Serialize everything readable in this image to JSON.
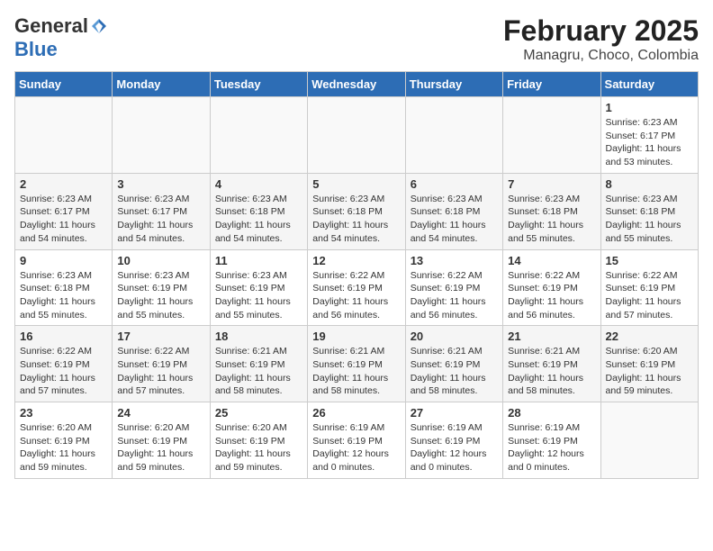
{
  "header": {
    "logo_general": "General",
    "logo_blue": "Blue",
    "month_title": "February 2025",
    "location": "Managru, Choco, Colombia"
  },
  "days_of_week": [
    "Sunday",
    "Monday",
    "Tuesday",
    "Wednesday",
    "Thursday",
    "Friday",
    "Saturday"
  ],
  "weeks": [
    [
      {
        "day": "",
        "info": ""
      },
      {
        "day": "",
        "info": ""
      },
      {
        "day": "",
        "info": ""
      },
      {
        "day": "",
        "info": ""
      },
      {
        "day": "",
        "info": ""
      },
      {
        "day": "",
        "info": ""
      },
      {
        "day": "1",
        "info": "Sunrise: 6:23 AM\nSunset: 6:17 PM\nDaylight: 11 hours and 53 minutes."
      }
    ],
    [
      {
        "day": "2",
        "info": "Sunrise: 6:23 AM\nSunset: 6:17 PM\nDaylight: 11 hours and 54 minutes."
      },
      {
        "day": "3",
        "info": "Sunrise: 6:23 AM\nSunset: 6:17 PM\nDaylight: 11 hours and 54 minutes."
      },
      {
        "day": "4",
        "info": "Sunrise: 6:23 AM\nSunset: 6:18 PM\nDaylight: 11 hours and 54 minutes."
      },
      {
        "day": "5",
        "info": "Sunrise: 6:23 AM\nSunset: 6:18 PM\nDaylight: 11 hours and 54 minutes."
      },
      {
        "day": "6",
        "info": "Sunrise: 6:23 AM\nSunset: 6:18 PM\nDaylight: 11 hours and 54 minutes."
      },
      {
        "day": "7",
        "info": "Sunrise: 6:23 AM\nSunset: 6:18 PM\nDaylight: 11 hours and 55 minutes."
      },
      {
        "day": "8",
        "info": "Sunrise: 6:23 AM\nSunset: 6:18 PM\nDaylight: 11 hours and 55 minutes."
      }
    ],
    [
      {
        "day": "9",
        "info": "Sunrise: 6:23 AM\nSunset: 6:18 PM\nDaylight: 11 hours and 55 minutes."
      },
      {
        "day": "10",
        "info": "Sunrise: 6:23 AM\nSunset: 6:19 PM\nDaylight: 11 hours and 55 minutes."
      },
      {
        "day": "11",
        "info": "Sunrise: 6:23 AM\nSunset: 6:19 PM\nDaylight: 11 hours and 55 minutes."
      },
      {
        "day": "12",
        "info": "Sunrise: 6:22 AM\nSunset: 6:19 PM\nDaylight: 11 hours and 56 minutes."
      },
      {
        "day": "13",
        "info": "Sunrise: 6:22 AM\nSunset: 6:19 PM\nDaylight: 11 hours and 56 minutes."
      },
      {
        "day": "14",
        "info": "Sunrise: 6:22 AM\nSunset: 6:19 PM\nDaylight: 11 hours and 56 minutes."
      },
      {
        "day": "15",
        "info": "Sunrise: 6:22 AM\nSunset: 6:19 PM\nDaylight: 11 hours and 57 minutes."
      }
    ],
    [
      {
        "day": "16",
        "info": "Sunrise: 6:22 AM\nSunset: 6:19 PM\nDaylight: 11 hours and 57 minutes."
      },
      {
        "day": "17",
        "info": "Sunrise: 6:22 AM\nSunset: 6:19 PM\nDaylight: 11 hours and 57 minutes."
      },
      {
        "day": "18",
        "info": "Sunrise: 6:21 AM\nSunset: 6:19 PM\nDaylight: 11 hours and 58 minutes."
      },
      {
        "day": "19",
        "info": "Sunrise: 6:21 AM\nSunset: 6:19 PM\nDaylight: 11 hours and 58 minutes."
      },
      {
        "day": "20",
        "info": "Sunrise: 6:21 AM\nSunset: 6:19 PM\nDaylight: 11 hours and 58 minutes."
      },
      {
        "day": "21",
        "info": "Sunrise: 6:21 AM\nSunset: 6:19 PM\nDaylight: 11 hours and 58 minutes."
      },
      {
        "day": "22",
        "info": "Sunrise: 6:20 AM\nSunset: 6:19 PM\nDaylight: 11 hours and 59 minutes."
      }
    ],
    [
      {
        "day": "23",
        "info": "Sunrise: 6:20 AM\nSunset: 6:19 PM\nDaylight: 11 hours and 59 minutes."
      },
      {
        "day": "24",
        "info": "Sunrise: 6:20 AM\nSunset: 6:19 PM\nDaylight: 11 hours and 59 minutes."
      },
      {
        "day": "25",
        "info": "Sunrise: 6:20 AM\nSunset: 6:19 PM\nDaylight: 11 hours and 59 minutes."
      },
      {
        "day": "26",
        "info": "Sunrise: 6:19 AM\nSunset: 6:19 PM\nDaylight: 12 hours and 0 minutes."
      },
      {
        "day": "27",
        "info": "Sunrise: 6:19 AM\nSunset: 6:19 PM\nDaylight: 12 hours and 0 minutes."
      },
      {
        "day": "28",
        "info": "Sunrise: 6:19 AM\nSunset: 6:19 PM\nDaylight: 12 hours and 0 minutes."
      },
      {
        "day": "",
        "info": ""
      }
    ]
  ]
}
